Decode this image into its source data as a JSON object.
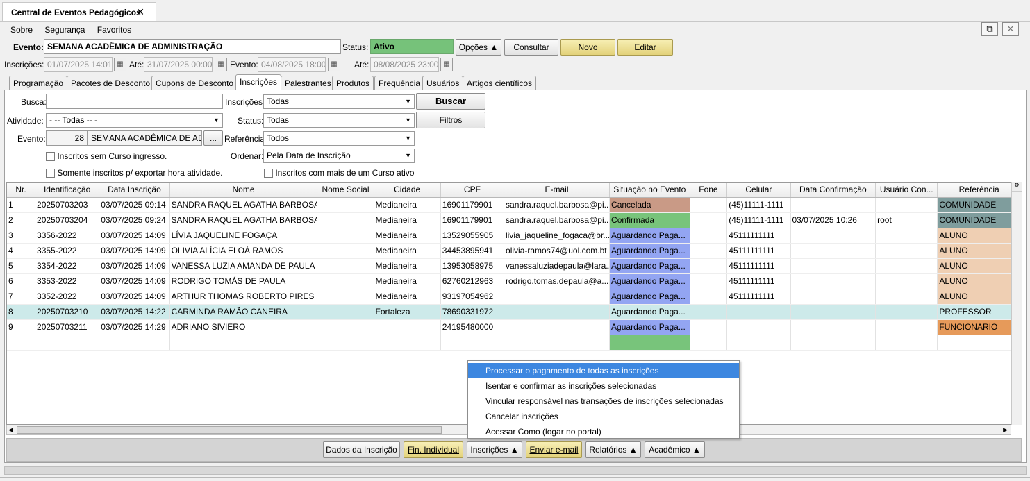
{
  "window": {
    "tab_title": "Central de Eventos Pedagógicos",
    "close_label": "✕"
  },
  "menu": [
    "Sobre",
    "Segurança",
    "Favoritos"
  ],
  "header": {
    "evento_label": "Evento:",
    "evento_value": "SEMANA ACADÊMICA DE ADMINISTRAÇÃO",
    "status_label": "Status:",
    "status_value": "Ativo",
    "status_color": "#76c27a",
    "opcoes_label": "Opções ▲",
    "consultar_label": "Consultar",
    "novo_label": "Novo",
    "editar_label": "Editar",
    "inscricoes_label": "Inscrições:",
    "inscricoes_de": "01/07/2025 14:01",
    "ate_label": "Até:",
    "inscricoes_ate": "31/07/2025 00:00",
    "evento_date_label": "Evento:",
    "evento_de": "04/08/2025 18:00",
    "ate2_label": "Até:",
    "evento_ate": "08/08/2025 23:00"
  },
  "tabs": [
    "Programação",
    "Pacotes de Desconto",
    "Cupons de Desconto",
    "Inscrições",
    "Palestrantes",
    "Produtos",
    "Frequência",
    "Usuários",
    "Artigos científicos"
  ],
  "filters": {
    "busca_label": "Busca:",
    "busca_value": "",
    "inscricoes_label": "Inscrições:",
    "inscricoes_value": "Todas",
    "buscar_label": "Buscar",
    "atividade_label": "Atividade:",
    "atividade_value": "- -- Todas -- -",
    "status_label": "Status:",
    "status_value": "Todas",
    "filtros_label": "Filtros",
    "evento_label": "Evento:",
    "evento_id": "28",
    "evento_name": "SEMANA ACADÊMICA DE ADM",
    "evento_btn": "...",
    "referencia_label": "Referência",
    "referencia_value": "Todos",
    "ordenar_label": "Ordenar:",
    "ordenar_value": "Pela Data de Inscrição",
    "chk1": "Inscritos sem Curso ingresso.",
    "chk2": "Somente inscritos p/ exportar hora atividade.",
    "chk3": "Inscritos com mais de um Curso ativo"
  },
  "table": {
    "columns": [
      "Nr.",
      "Identificação",
      "Data Inscrição",
      "Nome",
      "Nome Social",
      "Cidade",
      "CPF",
      "E-mail",
      "Situação no Evento",
      "Fone",
      "Celular",
      "Data Confirmação",
      "Usuário Con...",
      "Referência"
    ],
    "rows": [
      {
        "nr": "1",
        "id": "20250703203",
        "data": "03/07/2025 09:14",
        "nome": "SANDRA RAQUEL AGATHA BARBOSA",
        "social": "",
        "cidade": "Medianeira",
        "cpf": "16901179901",
        "email": "sandra.raquel.barbosa@pi...",
        "sit": "Cancelada",
        "sitc": "canc",
        "fone": "",
        "cel": "(45)11111-1111",
        "conf": "",
        "user": "",
        "ref": "COMUNIDADE",
        "refc": "com"
      },
      {
        "nr": "2",
        "id": "20250703204",
        "data": "03/07/2025 09:24",
        "nome": "SANDRA RAQUEL AGATHA BARBOSA",
        "social": "",
        "cidade": "Medianeira",
        "cpf": "16901179901",
        "email": "sandra.raquel.barbosa@pi...",
        "sit": "Confirmada",
        "sitc": "conf",
        "fone": "",
        "cel": "(45)11111-1111",
        "conf": "03/07/2025 10:26",
        "user": "root",
        "ref": "COMUNIDADE",
        "refc": "com"
      },
      {
        "nr": "3",
        "id": "3356-2022",
        "data": "03/07/2025 14:09",
        "nome": "LÍVIA JAQUELINE FOGAÇA",
        "social": "",
        "cidade": "Medianeira",
        "cpf": "13529055905",
        "email": "livia_jaqueline_fogaca@br...",
        "sit": "Aguardando Paga...",
        "sitc": "ag",
        "fone": "",
        "cel": "45111111111",
        "conf": "",
        "user": "",
        "ref": "ALUNO",
        "refc": "alu"
      },
      {
        "nr": "4",
        "id": "3355-2022",
        "data": "03/07/2025 14:09",
        "nome": "OLIVIA ALÍCIA ELOÁ RAMOS",
        "social": "",
        "cidade": "Medianeira",
        "cpf": "34453895941",
        "email": "olivia-ramos74@uol.com.bt",
        "sit": "Aguardando Paga...",
        "sitc": "ag",
        "fone": "",
        "cel": "45111111111",
        "conf": "",
        "user": "",
        "ref": "ALUNO",
        "refc": "alu"
      },
      {
        "nr": "5",
        "id": "3354-2022",
        "data": "03/07/2025 14:09",
        "nome": "VANESSA LUZIA AMANDA DE PAULA",
        "social": "",
        "cidade": "Medianeira",
        "cpf": "13953058975",
        "email": "vanessaluziadepaula@lara...",
        "sit": "Aguardando Paga...",
        "sitc": "ag",
        "fone": "",
        "cel": "45111111111",
        "conf": "",
        "user": "",
        "ref": "ALUNO",
        "refc": "alu"
      },
      {
        "nr": "6",
        "id": "3353-2022",
        "data": "03/07/2025 14:09",
        "nome": "RODRIGO TOMÁS DE PAULA",
        "social": "",
        "cidade": "Medianeira",
        "cpf": "62760212963",
        "email": "rodrigo.tomas.depaula@a...",
        "sit": "Aguardando Paga...",
        "sitc": "ag",
        "fone": "",
        "cel": "45111111111",
        "conf": "",
        "user": "",
        "ref": "ALUNO",
        "refc": "alu"
      },
      {
        "nr": "7",
        "id": "3352-2022",
        "data": "03/07/2025 14:09",
        "nome": "ARTHUR THOMAS ROBERTO PIRES",
        "social": "",
        "cidade": "Medianeira",
        "cpf": "93197054962",
        "email": "",
        "sit": "Aguardando Paga...",
        "sitc": "ag",
        "fone": "",
        "cel": "45111111111",
        "conf": "",
        "user": "",
        "ref": "ALUNO",
        "refc": "alu"
      },
      {
        "nr": "8",
        "id": "20250703210",
        "data": "03/07/2025 14:22",
        "nome": "CARMINDA RAMÃO CANEIRA",
        "social": "",
        "cidade": "Fortaleza",
        "cpf": "78690331972",
        "email": "",
        "sit": "Aguardando Paga...",
        "sitc": "ag",
        "fone": "",
        "cel": "",
        "conf": "",
        "user": "",
        "ref": "PROFESSOR",
        "refc": "prof",
        "selected": true
      },
      {
        "nr": "9",
        "id": "20250703211",
        "data": "03/07/2025 14:29",
        "nome": "ADRIANO SIVIERO",
        "social": "",
        "cidade": "",
        "cpf": "24195480000",
        "email": "",
        "sit": "Aguardando Paga...",
        "sitc": "ag",
        "fone": "",
        "cel": "",
        "conf": "",
        "user": "",
        "ref": "FUNCIONARIO",
        "refc": "func"
      },
      {
        "nr": "",
        "id": "",
        "data": "",
        "nome": "",
        "social": "",
        "cidade": "",
        "cpf": "",
        "email": "",
        "sit": "",
        "sitc": "conf",
        "fone": "",
        "cel": "",
        "conf": "",
        "user": "",
        "ref": "",
        "refc": ""
      }
    ]
  },
  "context_menu": [
    "Processar o pagamento de todas as inscrições",
    "Isentar e confirmar as inscrições selecionadas",
    "Vincular responsável nas transações de inscrições selecionadas",
    "Cancelar inscrições",
    "Acessar Como (logar no portal)"
  ],
  "bottom_buttons": {
    "dados": "Dados da Inscrição",
    "fin": "Fin. Individual",
    "insc": "Inscrições ▲",
    "email": "Enviar e-mail",
    "rel": "Relatórios ▲",
    "acad": "Acadêmico ▲"
  }
}
